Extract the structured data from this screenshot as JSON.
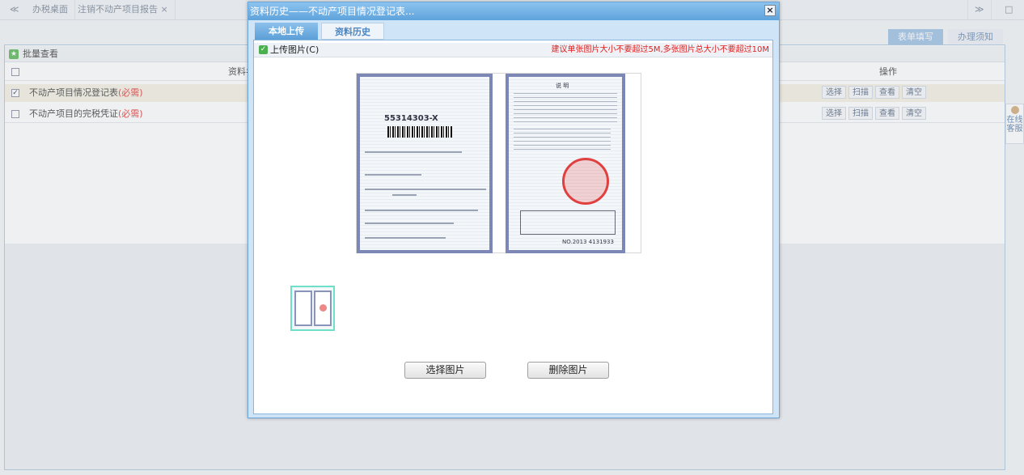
{
  "topbar": {
    "back": "≪",
    "tabs": [
      "办税桌面",
      "注销不动产项目报告"
    ],
    "close": "×",
    "forward": "≫",
    "menu": "□"
  },
  "right_tabs": [
    "表单填写",
    "办理须知"
  ],
  "panel": {
    "title": "批量查看",
    "col_name": "资料名",
    "col_ops": "操作",
    "rows": [
      {
        "name": "不动产项目情况登记表",
        "req": "(必需)",
        "checked": true
      },
      {
        "name": "不动产项目的完税凭证",
        "req": "(必需)",
        "checked": false
      }
    ],
    "ops": [
      "选择",
      "扫描",
      "查看",
      "清空"
    ]
  },
  "service": "在线客服",
  "modal": {
    "title": "资料历史——不动产项目情况登记表...",
    "close": "×",
    "tabs": [
      "本地上传",
      "资料历史"
    ],
    "upload_label": "上传图片(C)",
    "hint": "建议单张图片大小不要超过5M,多张图片总大小不要超过10M",
    "cert": {
      "code": "55314303-X",
      "no": "NO.2013 4131933",
      "heading": "说 明"
    },
    "select_button": "选择图片",
    "delete_button": "删除图片"
  },
  "colors": {
    "accent": "#5ea3dc",
    "hint": "#e02020",
    "required": "#e05050"
  }
}
